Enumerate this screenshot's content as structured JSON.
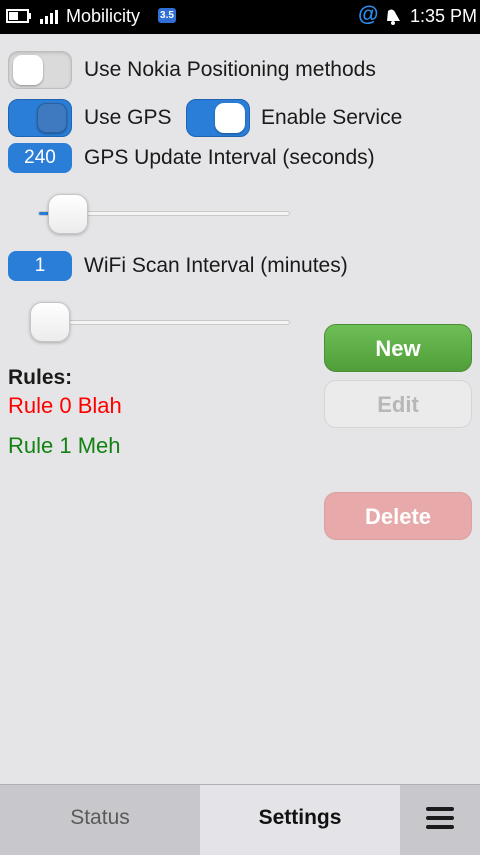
{
  "status_bar": {
    "carrier": "Mobilicity",
    "network_badge": "3.5",
    "time": "1:35 PM",
    "icons": [
      "battery-icon",
      "signal-icon",
      "at-icon",
      "notification-bell-icon"
    ]
  },
  "settings": {
    "nokia_positioning": {
      "label": "Use Nokia Positioning methods",
      "enabled": false
    },
    "use_gps": {
      "label": "Use GPS",
      "enabled": true
    },
    "enable_service": {
      "label": "Enable Service",
      "enabled": true
    },
    "gps_interval": {
      "value": "240",
      "label": "GPS Update Interval (seconds)",
      "slider_fraction": 0.08
    },
    "wifi_interval": {
      "value": "1",
      "label": "WiFi Scan Interval (minutes)",
      "slider_fraction": 0.0
    }
  },
  "rules": {
    "heading": "Rules:",
    "items": [
      {
        "label": "Rule 0 Blah",
        "color": "#ff0000"
      },
      {
        "label": "Rule 1 Meh",
        "color": "#128212"
      }
    ]
  },
  "actions": {
    "new_label": "New",
    "edit_label": "Edit",
    "delete_label": "Delete"
  },
  "tabs": {
    "status_label": "Status",
    "settings_label": "Settings",
    "active": "Settings"
  },
  "colors": {
    "accent": "#2a7ed8",
    "new_button": "#5aaa44",
    "delete_button": "#e7a9a9"
  }
}
